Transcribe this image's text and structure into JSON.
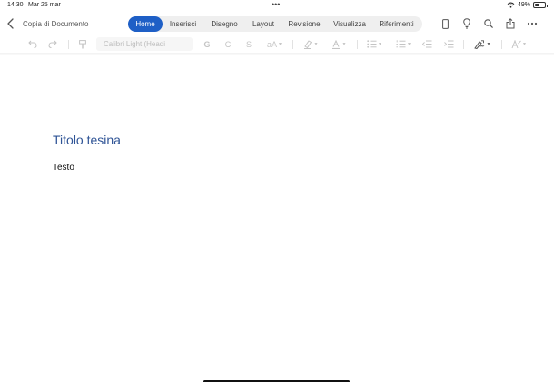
{
  "status_bar": {
    "time": "14:30",
    "date": "Mar 25 mar",
    "battery": "49%",
    "battery_level": 0.49,
    "wifi_icon": "wifi-icon",
    "battery_icon": "battery-icon"
  },
  "header": {
    "back_icon": "chevron-left-icon",
    "doc_title": "Copia di Documento",
    "tabs": [
      {
        "label": "Home",
        "active": true
      },
      {
        "label": "Inserisci",
        "active": false
      },
      {
        "label": "Disegno",
        "active": false
      },
      {
        "label": "Layout",
        "active": false
      },
      {
        "label": "Revisione",
        "active": false
      },
      {
        "label": "Visualizza",
        "active": false
      },
      {
        "label": "Riferimenti",
        "active": false
      }
    ],
    "icons": [
      "phone-view-icon",
      "lightbulb-icon",
      "search-icon",
      "share-icon",
      "more-icon"
    ]
  },
  "toolbar": {
    "font_name": "Calibri Light (Headi",
    "bold_label": "G",
    "italic_label": "C",
    "strike_label": "S",
    "font_size_label": "aA",
    "icons": [
      "undo-icon",
      "redo-icon",
      "format-painter-icon",
      "highlight-icon",
      "font-color-icon",
      "bullet-list-icon",
      "numbered-list-icon",
      "decrease-indent-icon",
      "increase-indent-icon",
      "track-changes-icon",
      "styles-icon"
    ]
  },
  "document": {
    "heading": "Titolo tesina",
    "body": "Testo"
  },
  "colors": {
    "accent": "#1e5fc6",
    "heading": "#2f5496",
    "disabled": "#c4c4c4"
  }
}
